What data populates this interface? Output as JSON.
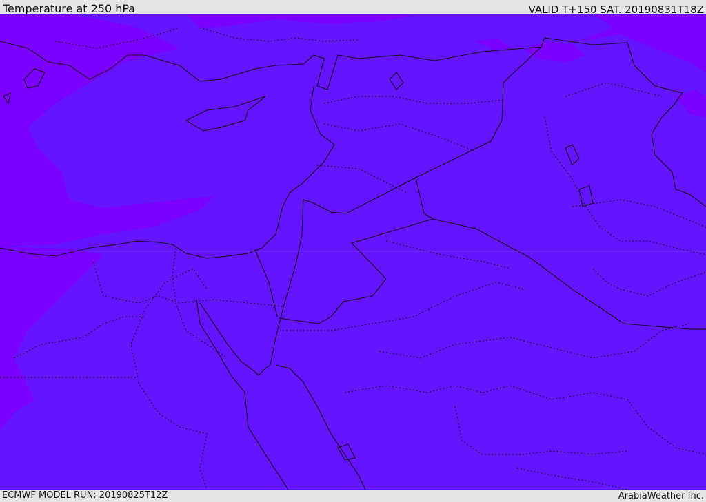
{
  "header": {
    "title": "Temperature at 250 hPa",
    "valid": "VALID T+150 SAT. 20190831T18Z"
  },
  "footer": {
    "model_run": "ECMWF MODEL RUN: 20190825T12Z",
    "credit": "ArabiaWeather Inc."
  },
  "colors": {
    "cold_band": "#7b00ff",
    "main_fill": "#6414ff",
    "borders": "#111111"
  },
  "map": {
    "variable": "temperature",
    "level": "250 hPa",
    "region": "Eastern Mediterranean / Middle East"
  }
}
